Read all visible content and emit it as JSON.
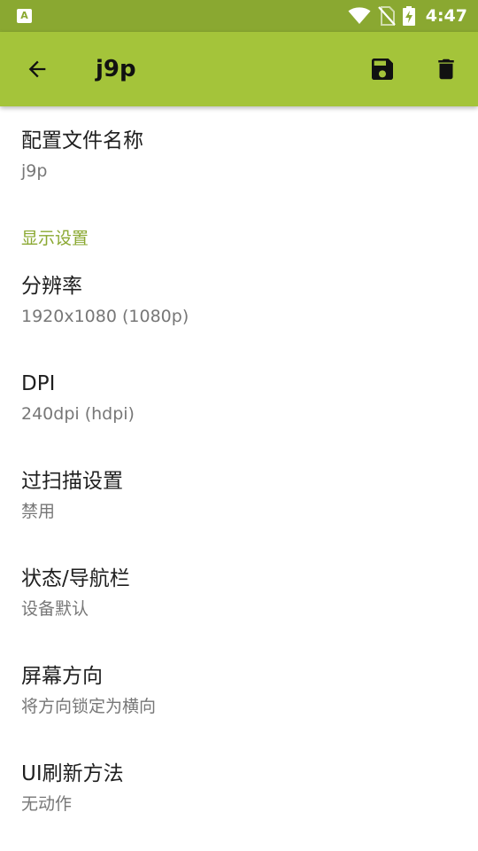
{
  "status_bar": {
    "app_icon_letter": "A",
    "time": "4:47",
    "icons": [
      "wifi-icon",
      "no-sim-icon",
      "battery-charging-icon"
    ]
  },
  "toolbar": {
    "title": "j9p",
    "back_icon": "arrow-left-icon",
    "save_icon": "save-icon",
    "delete_icon": "trash-icon"
  },
  "profile_name": {
    "title": "配置文件名称",
    "summary": "j9p"
  },
  "display_category": "显示设置",
  "settings": [
    {
      "title": "分辨率",
      "summary": "1920x1080 (1080p)"
    },
    {
      "title": "DPI",
      "summary": "240dpi (hdpi)"
    },
    {
      "title": "过扫描设置",
      "summary": "禁用"
    },
    {
      "title": "状态/导航栏",
      "summary": "设备默认"
    },
    {
      "title": "屏幕方向",
      "summary": "将方向锁定为横向"
    },
    {
      "title": "UI刷新方法",
      "summary": "无动作"
    }
  ],
  "colors": {
    "status_bar": "#8aa831",
    "app_bar": "#a4c43a",
    "accent": "#8aa831",
    "title_text": "#1f1f1f",
    "summary_text": "#777777"
  }
}
